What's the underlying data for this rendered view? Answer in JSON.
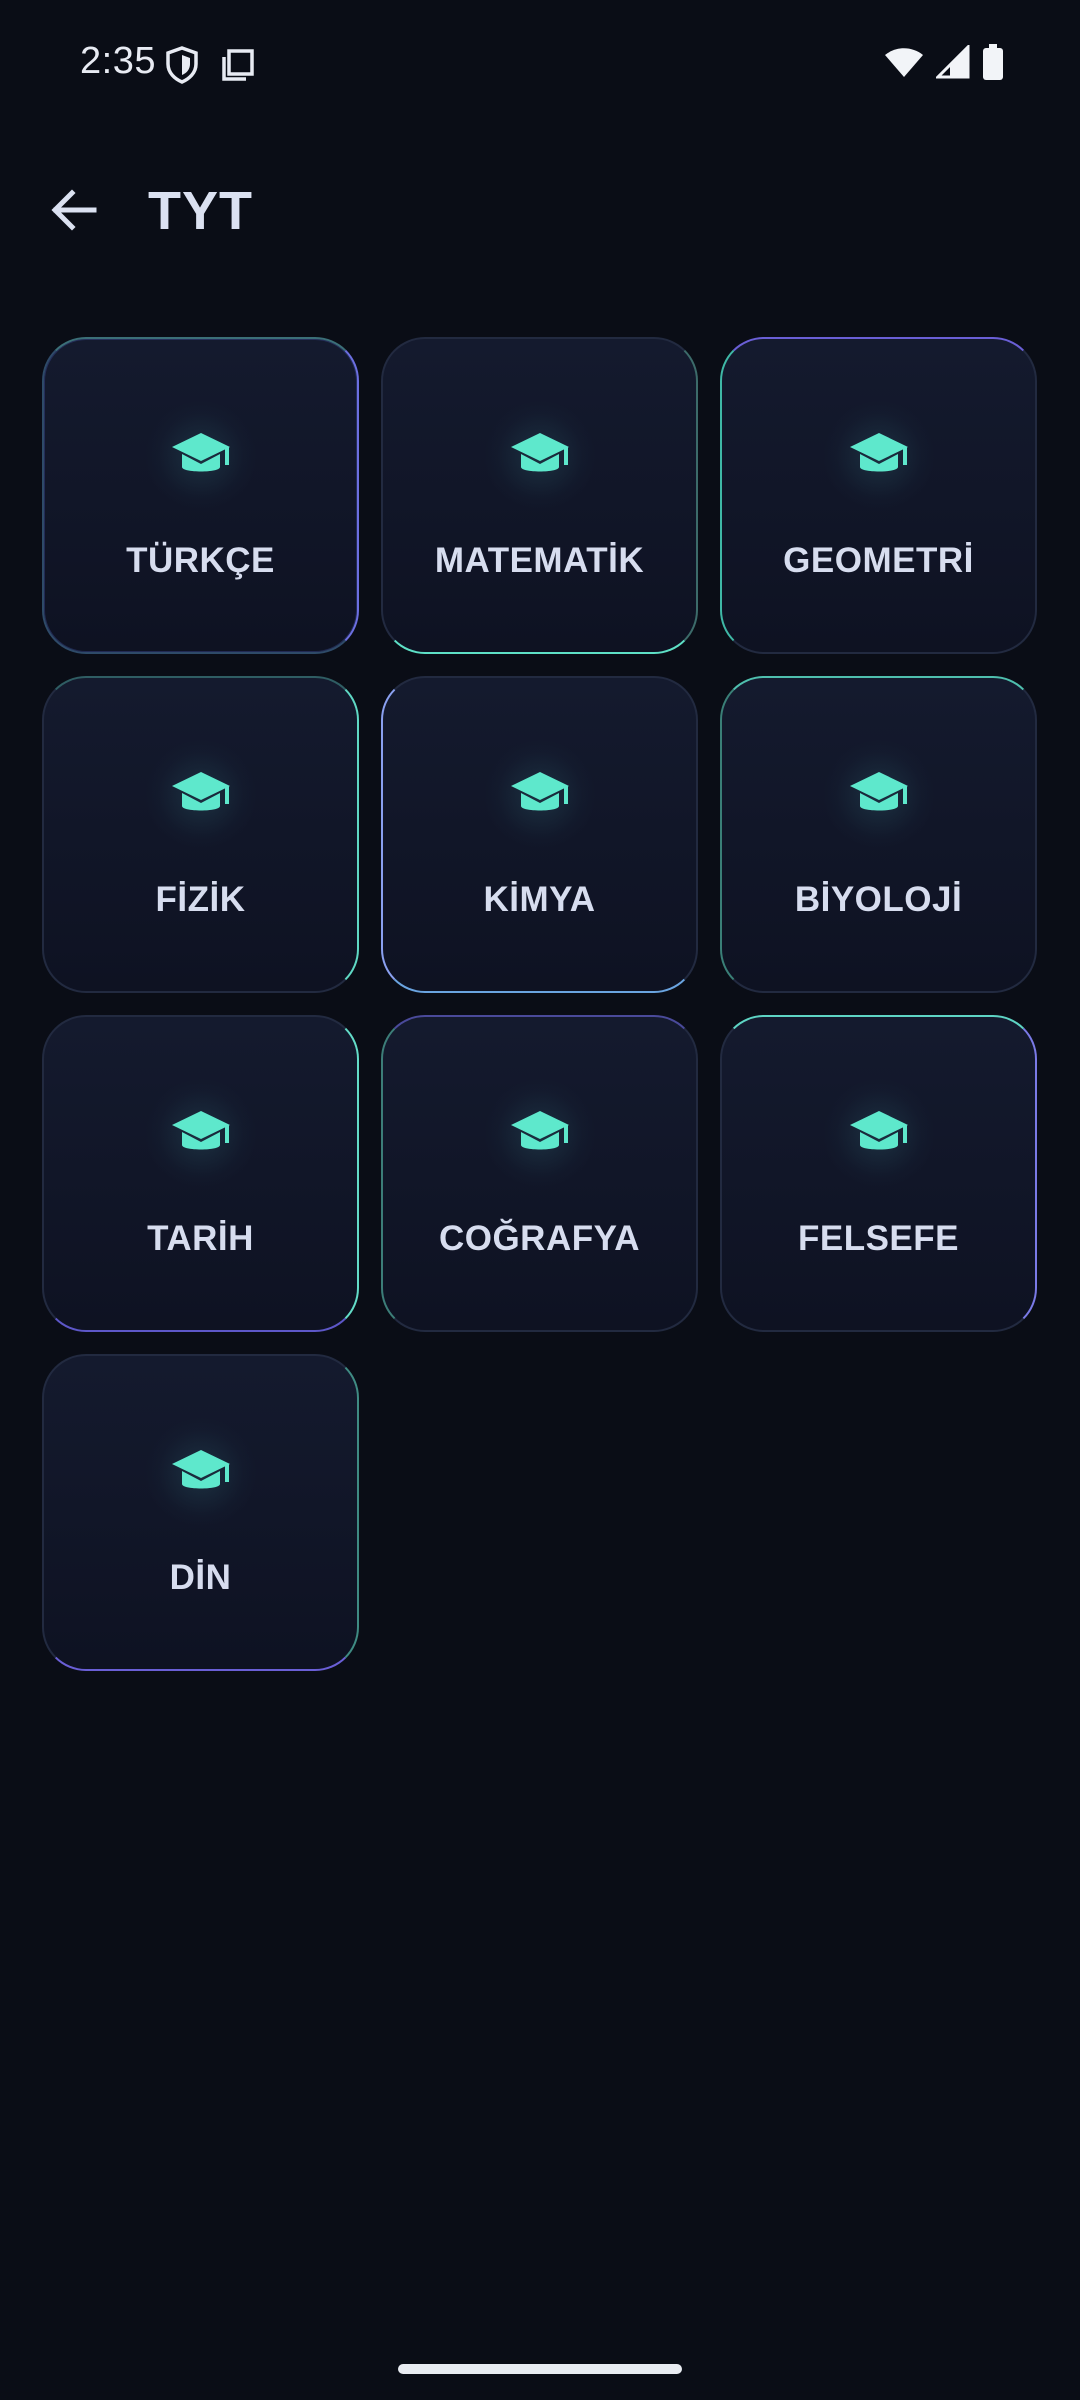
{
  "status_bar": {
    "time": "2:35",
    "icons": [
      "shield-icon",
      "screenshot-icon",
      "wifi-icon",
      "signal-icon",
      "battery-icon"
    ]
  },
  "app_bar": {
    "title": "TYT",
    "back_icon": "arrow-back-icon"
  },
  "subjects": [
    {
      "label": "TÜRKÇE"
    },
    {
      "label": "MATEMATİK"
    },
    {
      "label": "GEOMETRİ"
    },
    {
      "label": "FİZİK"
    },
    {
      "label": "KİMYA"
    },
    {
      "label": "BİYOLOJİ"
    },
    {
      "label": "TARİH"
    },
    {
      "label": "COĞRAFYA"
    },
    {
      "label": "FELSEFE"
    },
    {
      "label": "DİN"
    }
  ],
  "colors": {
    "background": "#0a0d16",
    "card": "#141a2e",
    "accent": "#5ee8cc",
    "text": "#d7ddef"
  }
}
